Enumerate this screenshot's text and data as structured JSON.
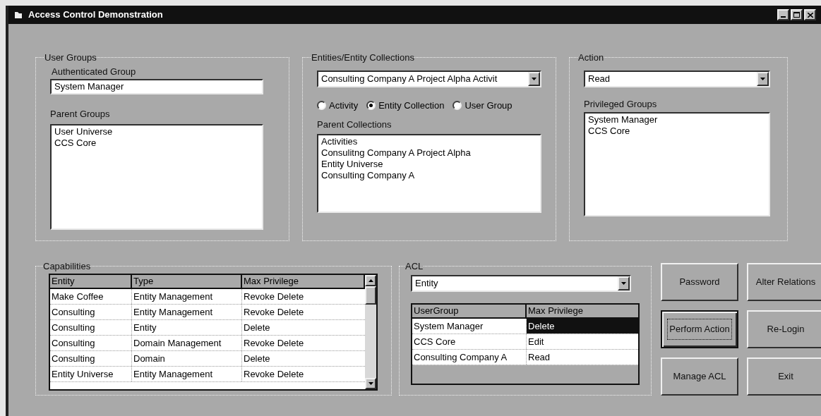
{
  "window": {
    "title": "Access Control Demonstration"
  },
  "user_groups": {
    "title": "User Groups",
    "authenticated_label": "Authenticated Group",
    "authenticated_value": "System Manager",
    "parent_label": "Parent Groups",
    "parent_groups": [
      "User Universe",
      "CCS Core"
    ]
  },
  "entities": {
    "title": "Entities/Entity Collections",
    "combo_value": "Consulting Company A Project Alpha Activit",
    "radios": [
      {
        "label": "Activity",
        "selected": false
      },
      {
        "label": "Entity Collection",
        "selected": true
      },
      {
        "label": "User Group",
        "selected": false
      }
    ],
    "parent_label": "Parent Collections",
    "parent_collections": [
      "Activities",
      "Consulitng Company A Project Alpha",
      "Entity Universe",
      "Consulting Company A"
    ]
  },
  "action": {
    "title": "Action",
    "combo_value": "Read",
    "privileged_label": "Privileged Groups",
    "privileged_groups": [
      "System Manager",
      "CCS Core"
    ]
  },
  "capabilities": {
    "title": "Capabilities",
    "columns": [
      "Entity",
      "Type",
      "Max Privilege"
    ],
    "rows": [
      [
        "Make Coffee",
        "Entity Management",
        "Revoke Delete"
      ],
      [
        "Consulting",
        "Entity Management",
        "Revoke Delete"
      ],
      [
        "Consulting",
        "Entity",
        "Delete"
      ],
      [
        "Consulting",
        "Domain Management",
        "Revoke Delete"
      ],
      [
        "Consulting",
        "Domain",
        "Delete"
      ],
      [
        "Entity Universe",
        "Entity Management",
        "Revoke Delete"
      ]
    ]
  },
  "acl": {
    "title": "ACL",
    "combo_value": "Entity",
    "columns": [
      "UserGroup",
      "Max Privilege"
    ],
    "rows": [
      {
        "cells": [
          "System Manager",
          "Delete"
        ],
        "selected": true
      },
      {
        "cells": [
          "CCS Core",
          "Edit"
        ],
        "selected": false
      },
      {
        "cells": [
          "Consulting Company A",
          "Read"
        ],
        "selected": false
      }
    ]
  },
  "buttons": [
    {
      "label": "Password",
      "focused": false
    },
    {
      "label": "Alter Relations",
      "focused": false
    },
    {
      "label": "Perform Action",
      "focused": true
    },
    {
      "label": "Re-Login",
      "focused": false
    },
    {
      "label": "Manage ACL",
      "focused": false
    },
    {
      "label": "Exit",
      "focused": false
    }
  ]
}
